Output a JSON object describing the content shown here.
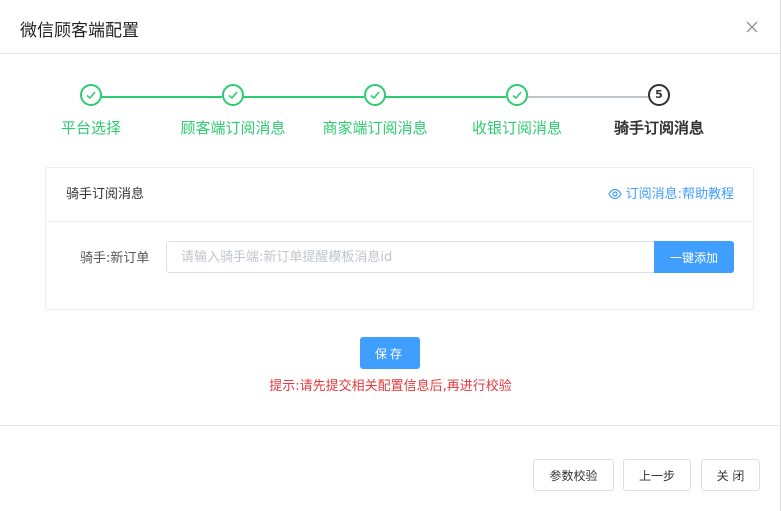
{
  "dialog": {
    "title": "微信顾客端配置"
  },
  "steps": [
    {
      "label": "平台选择",
      "status": "done"
    },
    {
      "label": "顾客端订阅消息",
      "status": "done"
    },
    {
      "label": "商家端订阅消息",
      "status": "done"
    },
    {
      "label": "收银订阅消息",
      "status": "done"
    },
    {
      "label": "骑手订阅消息",
      "status": "active",
      "number": "5"
    }
  ],
  "card": {
    "title": "骑手订阅消息",
    "help_label": "订阅消息:帮助教程",
    "field_label": "骑手:新订单",
    "input_value": "",
    "input_placeholder": "请输入骑手端:新订单提醒模板消息id",
    "add_button": "一键添加"
  },
  "save_button": "保存",
  "hint": "提示:请先提交相关配置信息后,再进行校验",
  "footer": {
    "verify_button": "参数校验",
    "prev_button": "上一步",
    "close_button": "关 闭"
  },
  "colors": {
    "done": "#2ecc71",
    "primary": "#409eff",
    "hint": "#e4393c"
  }
}
